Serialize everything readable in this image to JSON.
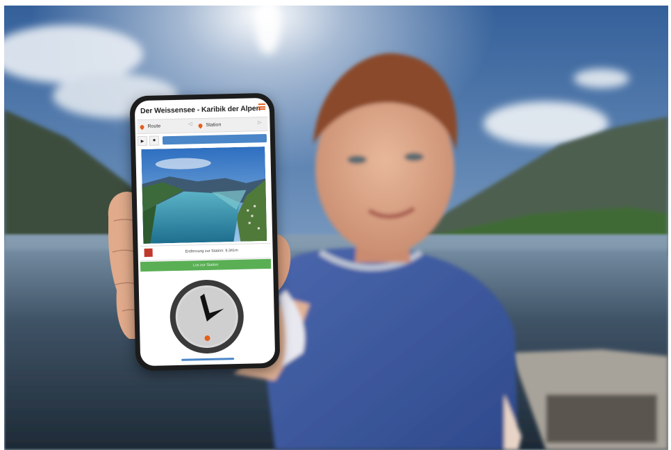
{
  "app": {
    "title": "Der Weissensee - Karibik der Alpen"
  },
  "tabs": [
    {
      "label": "Route",
      "icon": "map-pin-icon"
    },
    {
      "label": "Station",
      "icon": "map-pin-icon"
    }
  ],
  "player": {
    "play_icon": "play-icon",
    "stop_icon": "stop-icon"
  },
  "distance": {
    "text": "Entfernung zur Station: 9,341m"
  },
  "navigate_button": {
    "label": "Los zur Station"
  },
  "compass": {
    "icon": "compass-icon"
  },
  "colors": {
    "accent": "#e2601f",
    "progress": "#4a86c8",
    "button_green": "#5aaf55",
    "stop_red": "#c0392b"
  }
}
